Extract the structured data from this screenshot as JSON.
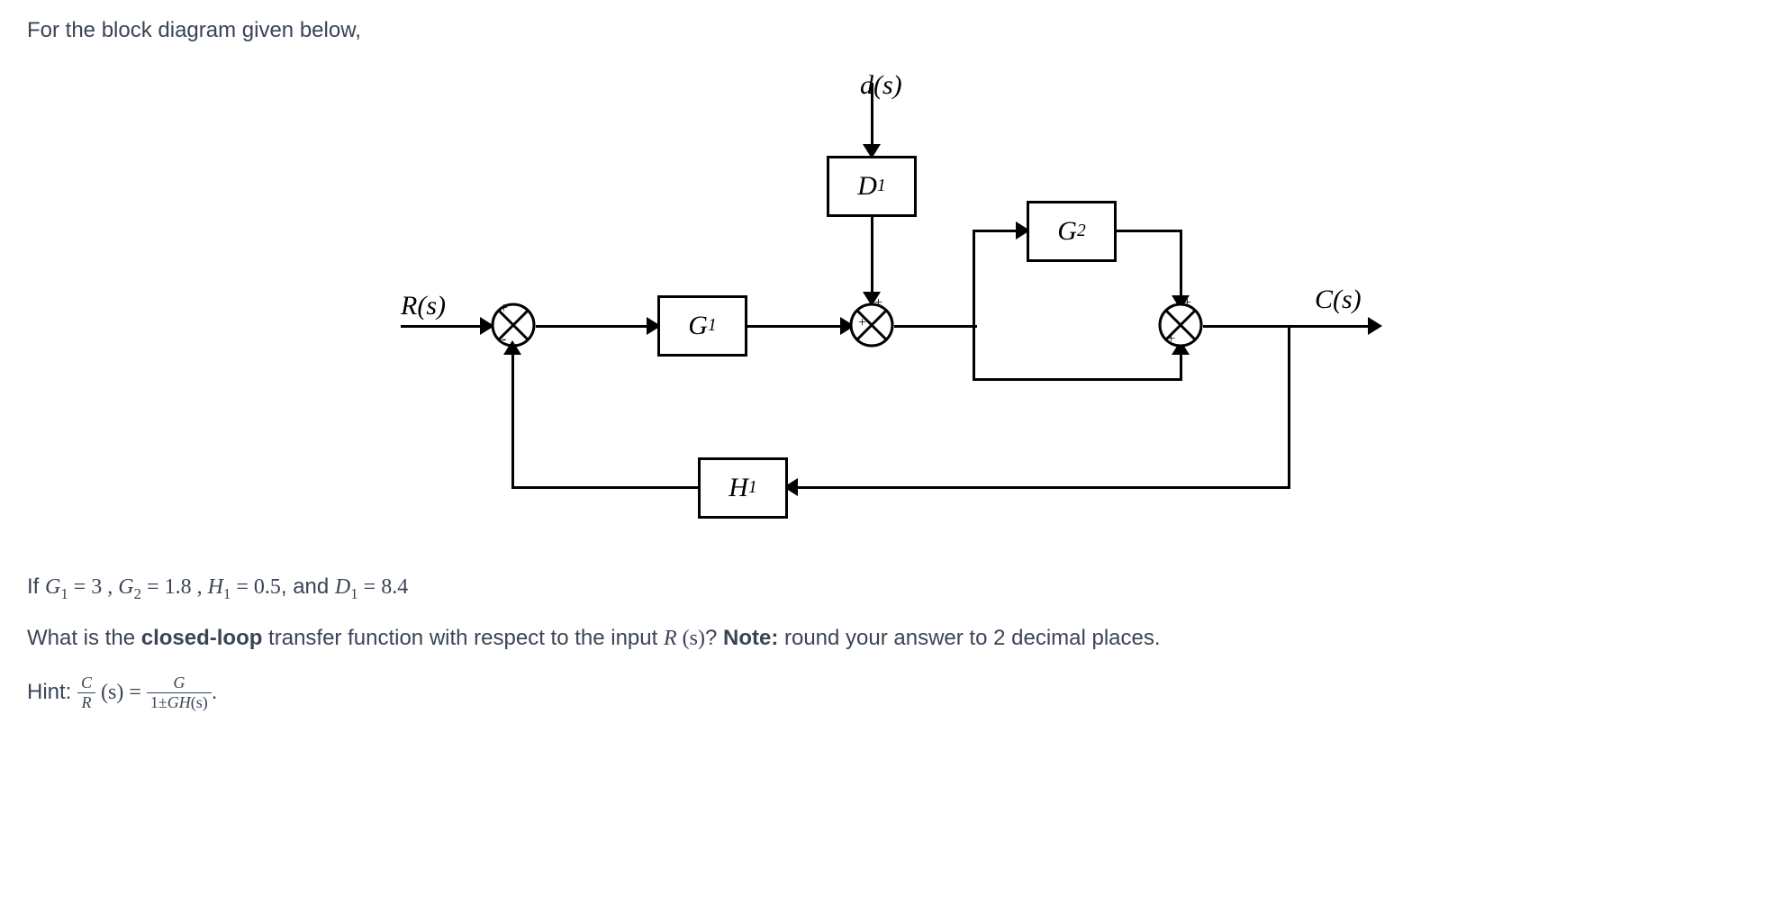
{
  "intro_text": "For the block diagram given below,",
  "diagram": {
    "input_label": "R(s)",
    "output_label": "C(s)",
    "disturbance_label": "d(s)",
    "block_G1": "G",
    "block_G1_sub": "1",
    "block_G2": "G",
    "block_G2_sub": "2",
    "block_D1": "D",
    "block_D1_sub": "1",
    "block_H1": "H",
    "block_H1_sub": "1",
    "sign_plus": "+",
    "sign_minus": "-"
  },
  "given": {
    "prefix": "If ",
    "G1_name": "G",
    "G1_sub": "1",
    "G1_val": "3",
    "G2_name": "G",
    "G2_sub": "2",
    "G2_val": "1.8",
    "H1_name": "H",
    "H1_sub": "1",
    "H1_val": "0.5",
    "D1_name": "D",
    "D1_sub": "1",
    "D1_val": "8.4",
    "equals": " = ",
    "comma": " , ",
    "and": ", and "
  },
  "prompt": {
    "part1": "What is the ",
    "bold": "closed-loop",
    "part2": " transfer function with respect to the input ",
    "input_var": "R",
    "input_arg": " (s)",
    "part3": "? ",
    "note_bold": "Note:",
    "note_text": " round your answer to 2 decimal places."
  },
  "hint": {
    "label": "Hint: ",
    "lhs_num": "C",
    "lhs_den": "R",
    "arg": " (s) = ",
    "rhs_num": "G",
    "rhs_den_1": "1±",
    "rhs_den_2": "GH",
    "rhs_den_3": "(s)",
    "period": "."
  }
}
